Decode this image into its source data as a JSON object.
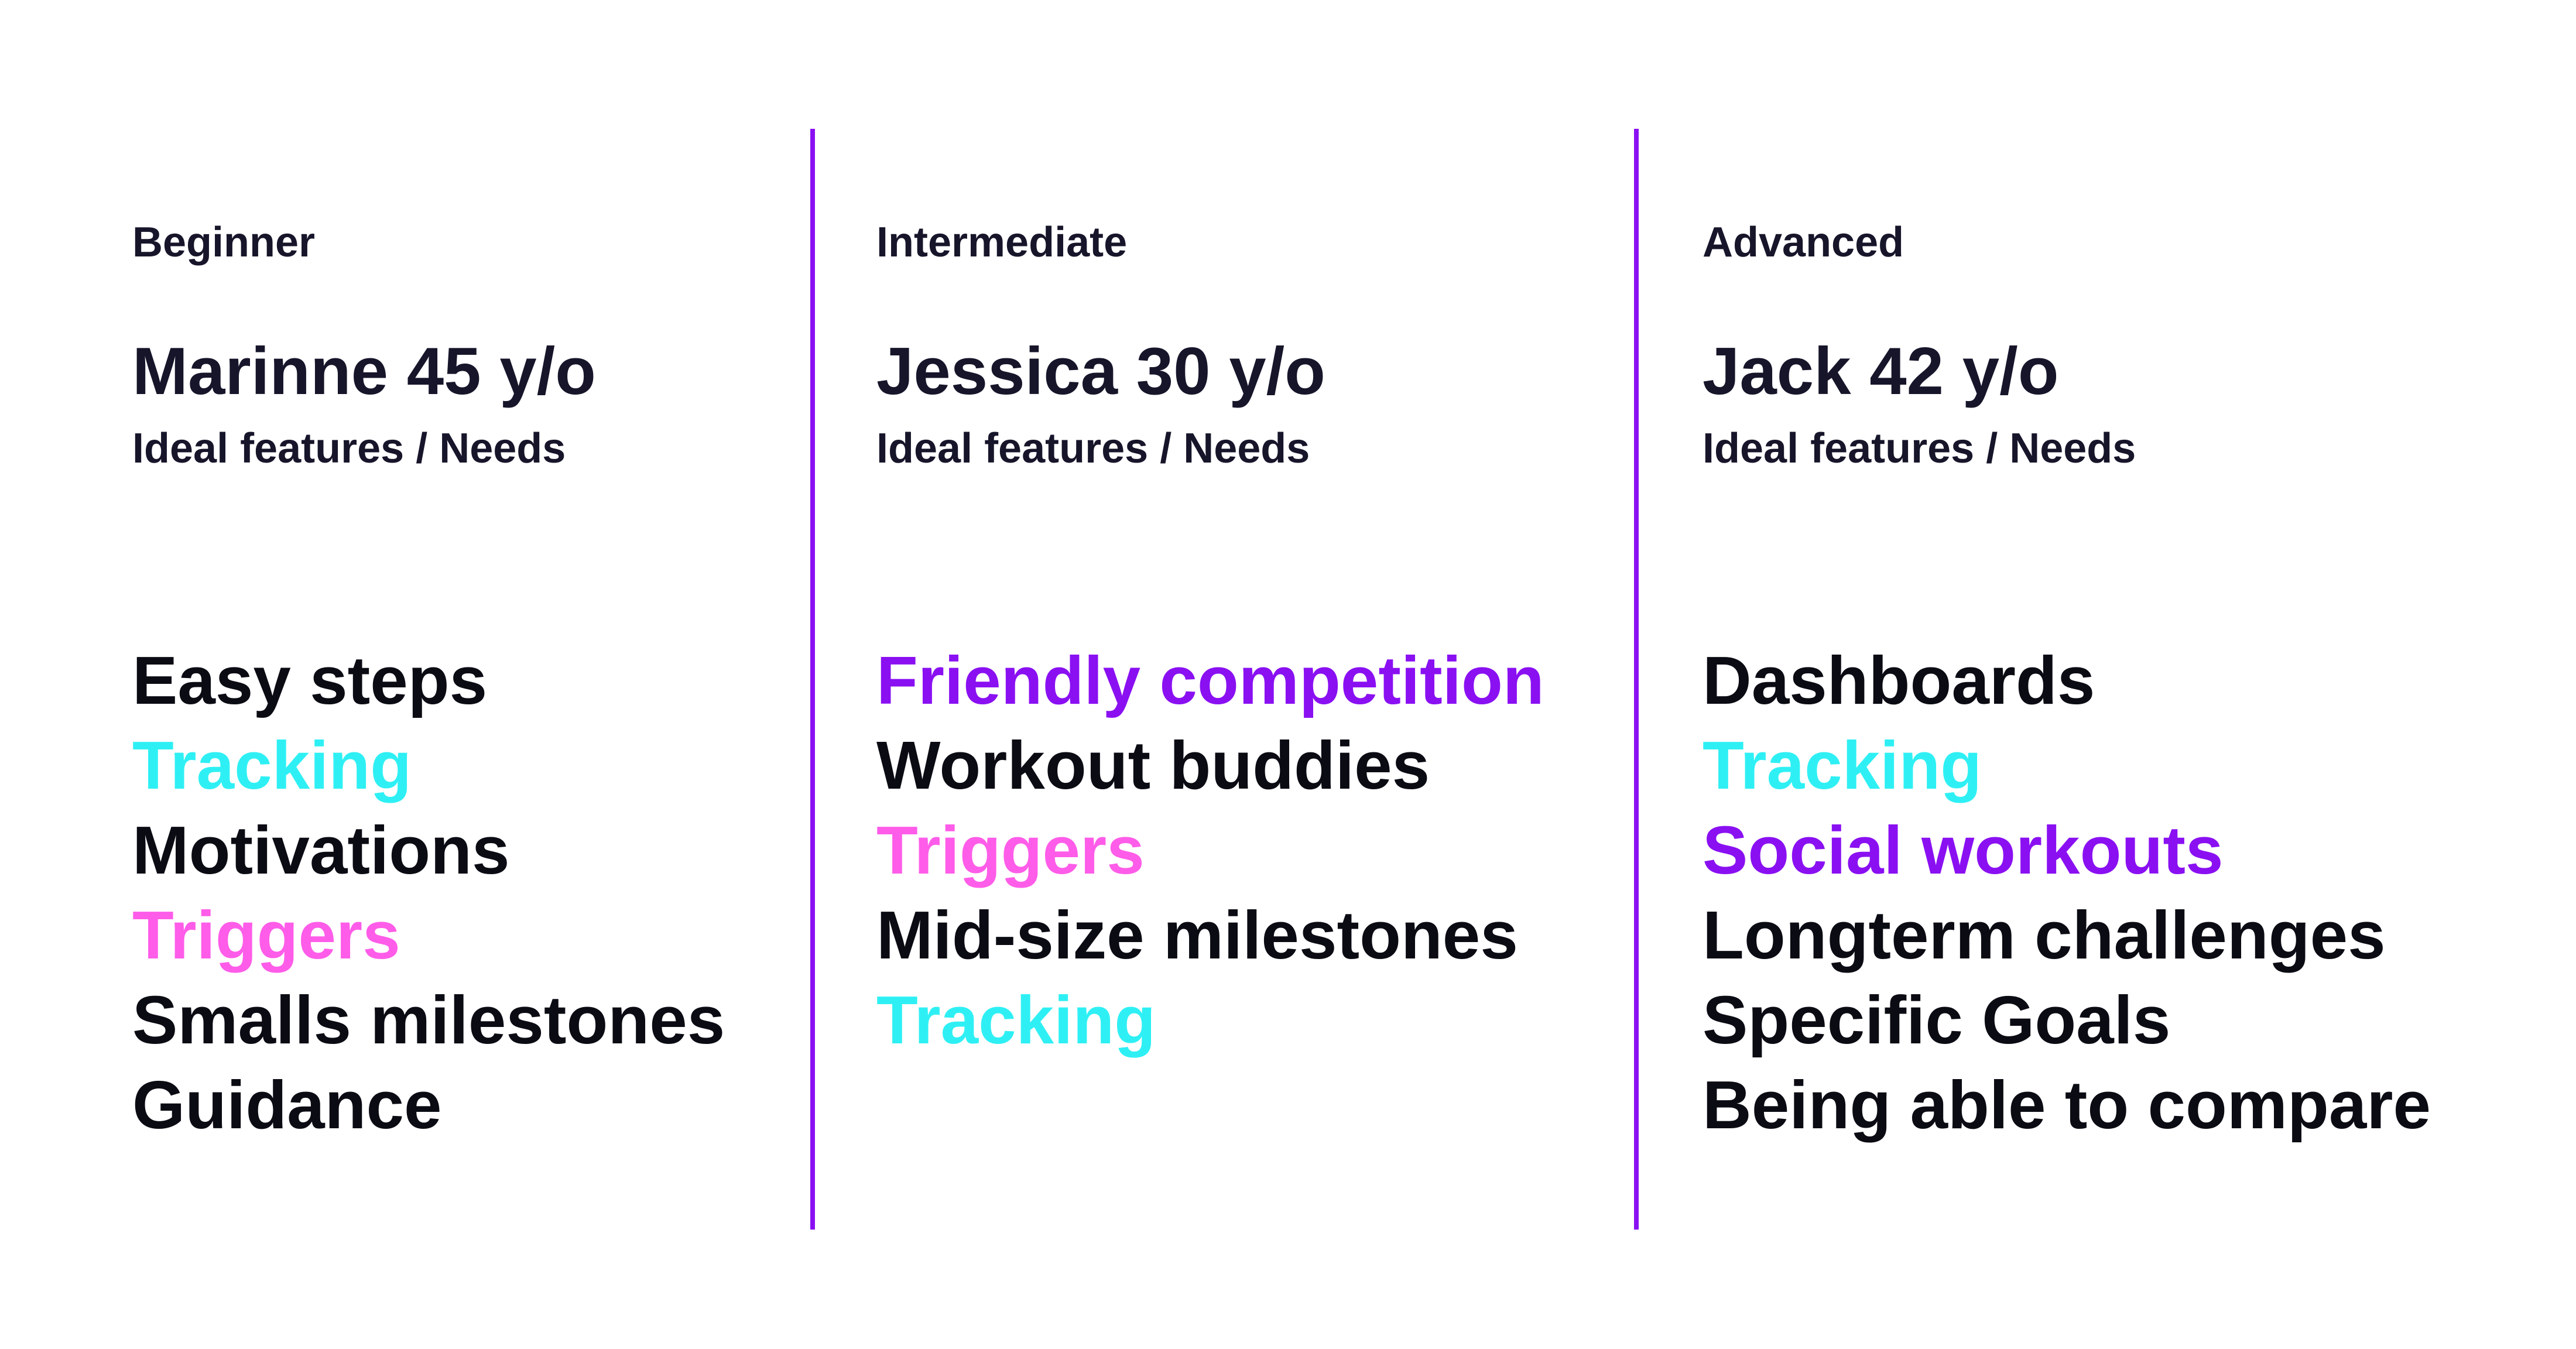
{
  "accent_color": "#8a10f2",
  "colors": {
    "dark": "#0b0b14",
    "cyan": "#2ef0f4",
    "pink": "#ff5ce9",
    "purple": "#8a10f2"
  },
  "columns": [
    {
      "level": "Beginner",
      "persona": "Marinne 45 y/o",
      "subtitle": "Ideal features / Needs",
      "features": [
        {
          "label": "Easy steps",
          "color": "dark"
        },
        {
          "label": "Tracking",
          "color": "cyan"
        },
        {
          "label": "Motivations",
          "color": "dark"
        },
        {
          "label": "Triggers",
          "color": "pink"
        },
        {
          "label": "Smalls milestones",
          "color": "dark"
        },
        {
          "label": "Guidance",
          "color": "dark"
        }
      ]
    },
    {
      "level": "Intermediate",
      "persona": "Jessica 30 y/o",
      "subtitle": "Ideal features / Needs",
      "features": [
        {
          "label": "Friendly competition",
          "color": "purple"
        },
        {
          "label": "Workout buddies",
          "color": "dark"
        },
        {
          "label": "Triggers",
          "color": "pink"
        },
        {
          "label": "Mid-size milestones",
          "color": "dark"
        },
        {
          "label": "Tracking",
          "color": "cyan"
        }
      ]
    },
    {
      "level": "Advanced",
      "persona": "Jack 42 y/o",
      "subtitle": "Ideal features / Needs",
      "features": [
        {
          "label": "Dashboards",
          "color": "dark"
        },
        {
          "label": "Tracking",
          "color": "cyan"
        },
        {
          "label": "Social workouts",
          "color": "purple"
        },
        {
          "label": "Longterm challenges",
          "color": "dark"
        },
        {
          "label": "Specific Goals",
          "color": "dark"
        },
        {
          "label": "Being able to compare",
          "color": "dark"
        }
      ]
    }
  ]
}
